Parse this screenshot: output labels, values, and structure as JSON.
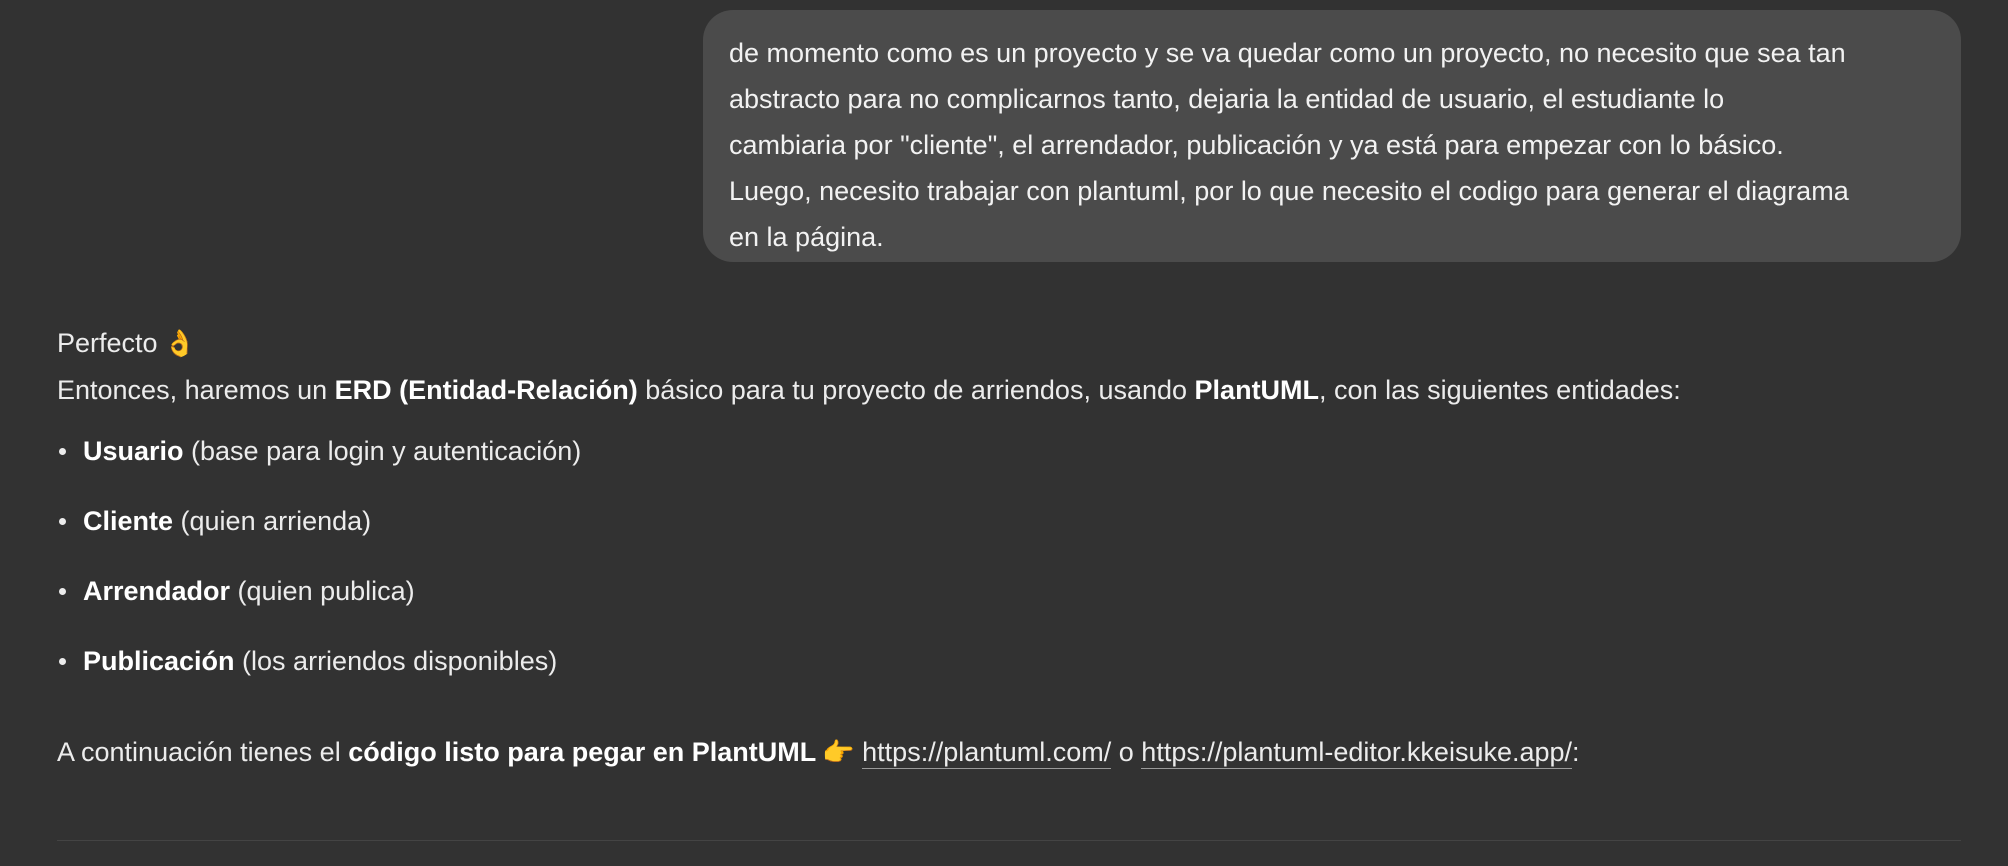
{
  "user_message": {
    "lines": [
      "de momento como es un proyecto y se va quedar como un proyecto, no necesito que sea tan",
      "abstracto para no complicarnos tanto, dejaria la entidad de usuario, el estudiante lo",
      "cambiaria por \"cliente\", el arrendador, publicación y ya está para empezar con lo básico.",
      "Luego, necesito trabajar con plantuml, por lo que necesito el codigo para generar el diagrama",
      "en la página."
    ]
  },
  "assistant_message": {
    "greeting": "Perfecto",
    "greeting_emoji": "👌",
    "intro": {
      "t1": "Entonces, haremos un ",
      "b1": "ERD (Entidad-Relación)",
      "t2": " básico para tu proyecto de arriendos, usando ",
      "b2": "PlantUML",
      "t3": ", con las siguientes entidades:"
    },
    "entities": [
      {
        "name": "Usuario",
        "desc": " (base para login y autenticación)"
      },
      {
        "name": "Cliente",
        "desc": " (quien arrienda)"
      },
      {
        "name": "Arrendador",
        "desc": " (quien publica)"
      },
      {
        "name": "Publicación",
        "desc": " (los arriendos disponibles)"
      }
    ],
    "code_intro": {
      "t1": "A continuación tienes el ",
      "b1": "código listo para pegar en PlantUML",
      "emoji": "👉",
      "link1": "https://plantuml.com/",
      "sep": " o ",
      "link2": "https://plantuml-editor.kkeisuke.app/",
      "end": ":"
    }
  }
}
